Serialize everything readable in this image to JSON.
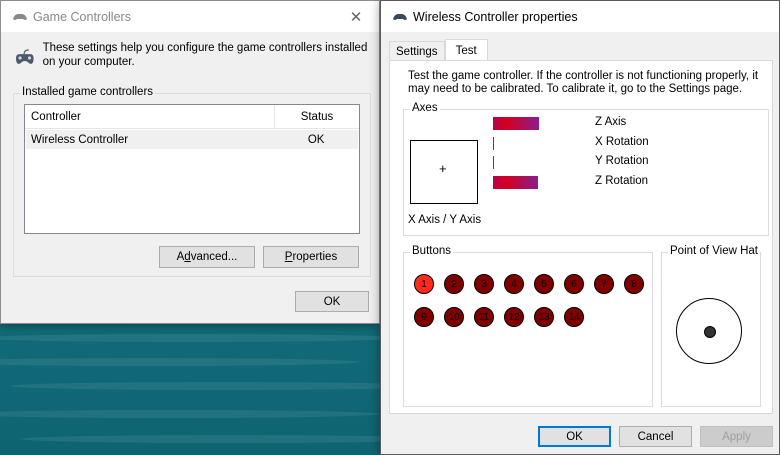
{
  "game_controllers": {
    "title": "Game Controllers",
    "close_glyph": "✕",
    "info_text": "These settings help you configure the game controllers installed on your computer.",
    "group_label": "Installed game controllers",
    "columns": [
      "Controller",
      "Status"
    ],
    "rows": [
      {
        "controller": "Wireless Controller",
        "status": "OK"
      }
    ],
    "advanced_label_pre": "A",
    "advanced_label_u": "d",
    "advanced_label_post": "vanced...",
    "properties_label_u": "P",
    "properties_label_post": "roperties",
    "ok_label": "OK"
  },
  "properties": {
    "title": "Wireless Controller properties",
    "tabs": [
      "Settings",
      "Test"
    ],
    "active_tab": "Test",
    "description": "Test the game controller.  If the controller is not functioning properly, it may need to be calibrated.  To calibrate it, go to the Settings page.",
    "axes_label": "Axes",
    "xy_label": "X Axis / Y Axis",
    "xy_cross": "+",
    "axes": [
      {
        "name": "Z Axis",
        "level": 0.34
      },
      {
        "name": "X Rotation",
        "level": 0.0
      },
      {
        "name": "Y Rotation",
        "level": 0.0
      },
      {
        "name": "Z Rotation",
        "level": 0.33
      }
    ],
    "buttons_label": "Buttons",
    "buttons": [
      {
        "label": "1",
        "pressed": true
      },
      {
        "label": "2",
        "pressed": false
      },
      {
        "label": "3",
        "pressed": false
      },
      {
        "label": "4",
        "pressed": false
      },
      {
        "label": "5",
        "pressed": false
      },
      {
        "label": "6",
        "pressed": false
      },
      {
        "label": "7",
        "pressed": false
      },
      {
        "label": "8",
        "pressed": false
      },
      {
        "label": "9",
        "pressed": false
      },
      {
        "label": "10",
        "pressed": false
      },
      {
        "label": "11",
        "pressed": false
      },
      {
        "label": "12",
        "pressed": false
      },
      {
        "label": "13",
        "pressed": false
      },
      {
        "label": "14",
        "pressed": false
      }
    ],
    "pov_label": "Point of View Hat",
    "ok_label": "OK",
    "cancel_label": "Cancel",
    "apply_label": "Apply"
  },
  "colors": {
    "bar_gradient_start": "#b8004c",
    "bar_gradient_end": "#8a1d8e",
    "button_idle": "#800000",
    "button_pressed": "#ff2a1a",
    "default_button_border": "#0078d7"
  },
  "icons": {
    "window_icon": "gamepad-icon",
    "info_icon": "gamepad-icon"
  }
}
